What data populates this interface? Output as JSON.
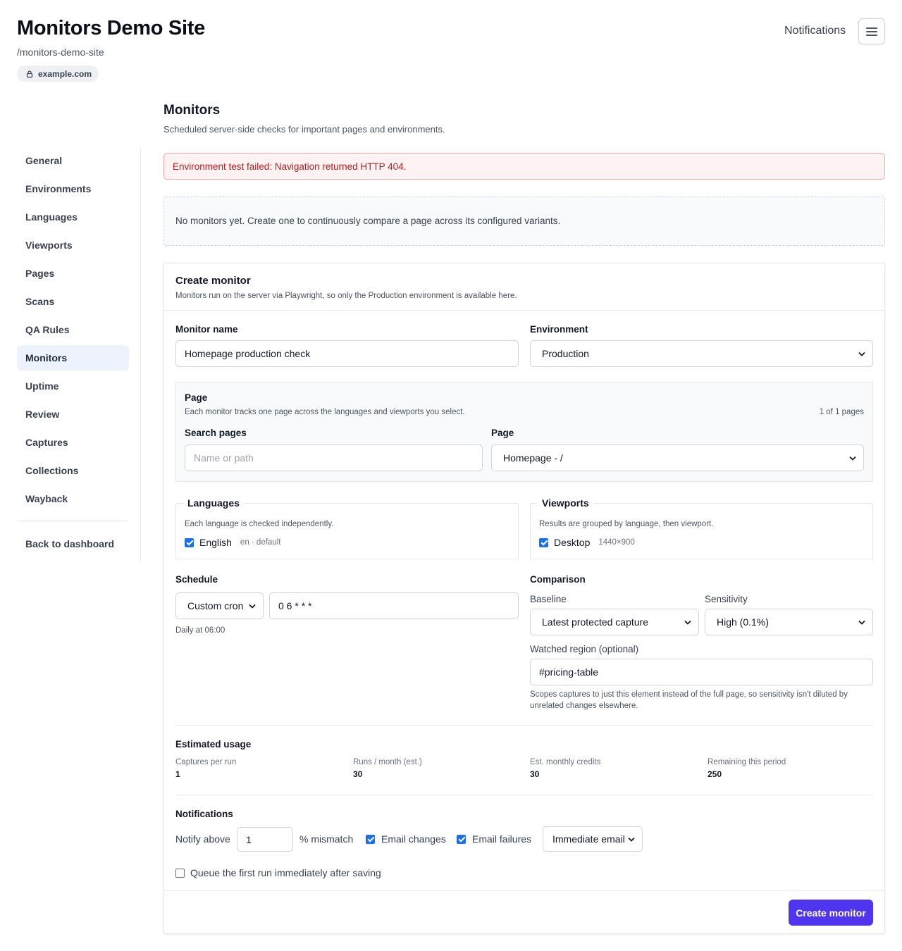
{
  "header": {
    "title": "Monitors Demo Site",
    "slug": "/monitors-demo-site",
    "domain": "example.com",
    "notifications_label": "Notifications",
    "menu_icon": "hamburger-icon"
  },
  "sidebar": {
    "items": [
      {
        "label": "General",
        "active": false
      },
      {
        "label": "Environments",
        "active": false
      },
      {
        "label": "Languages",
        "active": false
      },
      {
        "label": "Viewports",
        "active": false
      },
      {
        "label": "Pages",
        "active": false
      },
      {
        "label": "Scans",
        "active": false
      },
      {
        "label": "QA Rules",
        "active": false
      },
      {
        "label": "Monitors",
        "active": true
      },
      {
        "label": "Uptime",
        "active": false
      },
      {
        "label": "Review",
        "active": false
      },
      {
        "label": "Captures",
        "active": false
      },
      {
        "label": "Collections",
        "active": false
      },
      {
        "label": "Wayback",
        "active": false
      }
    ],
    "back_label": "Back to dashboard"
  },
  "main": {
    "title": "Monitors",
    "subtitle": "Scheduled server-side checks for important pages and environments.",
    "alert": "Environment test failed: Navigation returned HTTP 404.",
    "empty_state": "No monitors yet. Create one to continuously compare a page across its configured variants."
  },
  "form": {
    "title": "Create monitor",
    "subtitle": "Monitors run on the server via Playwright, so only the Production environment is available here.",
    "monitor_name_label": "Monitor name",
    "monitor_name_value": "Homepage production check",
    "environment_label": "Environment",
    "environment_value": "Production",
    "page_section": {
      "title": "Page",
      "description": "Each monitor tracks one page across the languages and viewports you select.",
      "count": "1 of 1 pages",
      "search_label": "Search pages",
      "search_placeholder": "Name or path",
      "page_label": "Page",
      "page_value": "Homepage - /"
    },
    "languages": {
      "legend": "Languages",
      "description": "Each language is checked independently.",
      "options": [
        {
          "label": "English",
          "meta": "en · default",
          "checked": true
        }
      ]
    },
    "viewports": {
      "legend": "Viewports",
      "description": "Results are grouped by language, then viewport.",
      "options": [
        {
          "label": "Desktop",
          "meta": "1440×900",
          "checked": true
        }
      ]
    },
    "schedule": {
      "label": "Schedule",
      "mode": "Custom cron",
      "cron": "0 6 * * *",
      "hint": "Daily at 06:00"
    },
    "comparison": {
      "label": "Comparison",
      "baseline_label": "Baseline",
      "baseline_value": "Latest protected capture",
      "sensitivity_label": "Sensitivity",
      "sensitivity_value": "High (0.1%)",
      "region_label": "Watched region (optional)",
      "region_value": "#pricing-table",
      "region_hint": "Scopes captures to just this element instead of the full page, so sensitivity isn't diluted by unrelated changes elsewhere."
    },
    "usage": {
      "title": "Estimated usage",
      "stats": [
        {
          "label": "Captures per run",
          "value": "1"
        },
        {
          "label": "Runs / month (est.)",
          "value": "30"
        },
        {
          "label": "Est. monthly credits",
          "value": "30"
        },
        {
          "label": "Remaining this period",
          "value": "250"
        }
      ]
    },
    "notifications": {
      "title": "Notifications",
      "notify_above_label": "Notify above",
      "notify_above_value": "1",
      "mismatch_suffix": "% mismatch",
      "email_changes_label": "Email changes",
      "email_changes_checked": true,
      "email_failures_label": "Email failures",
      "email_failures_checked": true,
      "delivery_value": "Immediate email"
    },
    "queue_label": "Queue the first run immediately after saving",
    "queue_checked": false,
    "submit_label": "Create monitor"
  },
  "colors": {
    "accent": "#4f35f0",
    "checkbox": "#1d6ff2",
    "alert_text": "#b91c1c",
    "alert_bg": "#fef2f2",
    "active_nav_bg": "#eef2fc"
  }
}
